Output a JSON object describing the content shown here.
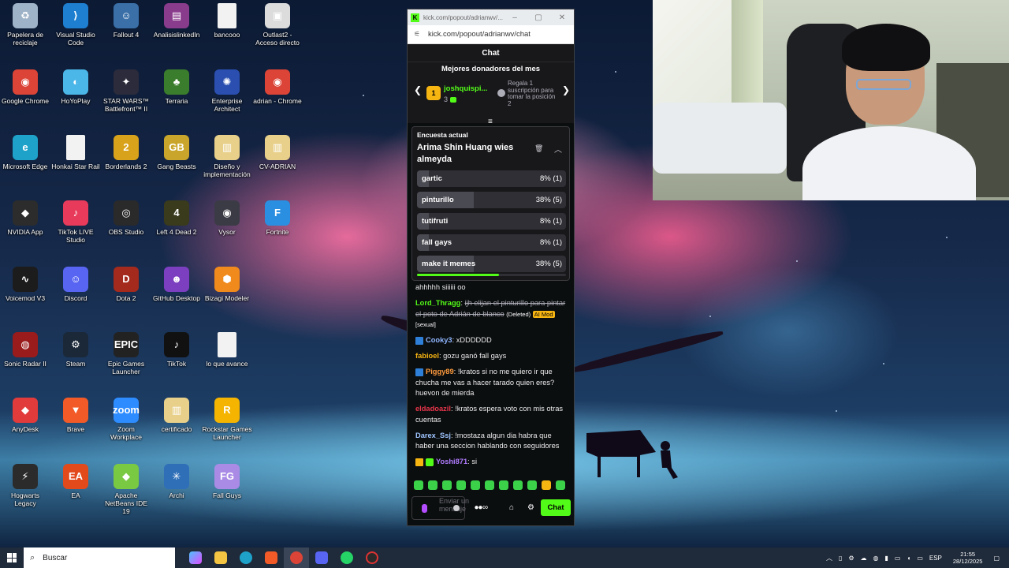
{
  "desktop": {
    "icons": [
      {
        "label": "Papelera de reciclaje",
        "icon": "recycle-bin-icon",
        "color": "#9fb3c8",
        "glyph": "♻"
      },
      {
        "label": "Visual Studio Code",
        "icon": "vscode-icon",
        "color": "#1e7fd0",
        "glyph": "⟩"
      },
      {
        "label": "Fallout 4",
        "icon": "fallout-icon",
        "color": "#3a6fa8",
        "glyph": "☺"
      },
      {
        "label": "AnalisislinkedIn",
        "icon": "winrar-icon",
        "color": "#8a3c8c",
        "glyph": "▤"
      },
      {
        "label": "bancooo",
        "icon": "file-icon",
        "color": "#f2f2f2",
        "glyph": ""
      },
      {
        "label": "Outlast2 - Acceso directo",
        "icon": "shortcut-icon",
        "color": "#dcdcdc",
        "glyph": "▣"
      },
      {
        "label": "Google Chrome",
        "icon": "chrome-icon",
        "color": "#db4437",
        "glyph": "◉"
      },
      {
        "label": "HoYoPlay",
        "icon": "hoyoplay-icon",
        "color": "#4bb6e8",
        "glyph": "◐"
      },
      {
        "label": "STAR WARS™ Battlefront™ II",
        "icon": "starwars-icon",
        "color": "#2b2b3b",
        "glyph": "✦"
      },
      {
        "label": "Terraria",
        "icon": "terraria-icon",
        "color": "#3a7d2c",
        "glyph": "♣"
      },
      {
        "label": "Enterprise Architect",
        "icon": "enterprise-architect-icon",
        "color": "#2a4fb0",
        "glyph": "✺"
      },
      {
        "label": "adrian - Chrome",
        "icon": "chrome-profile-icon",
        "color": "#db4437",
        "glyph": "◉"
      },
      {
        "label": "Microsoft Edge",
        "icon": "edge-icon",
        "color": "#1fa2c9",
        "glyph": "e"
      },
      {
        "label": "Honkai Star Rail",
        "icon": "file-icon",
        "color": "#f2f2f2",
        "glyph": ""
      },
      {
        "label": "Borderlands 2",
        "icon": "borderlands-icon",
        "color": "#d9a21b",
        "glyph": "2"
      },
      {
        "label": "Gang Beasts",
        "icon": "gang-beasts-icon",
        "color": "#c9a62b",
        "glyph": "GB"
      },
      {
        "label": "Diseño y implementación",
        "icon": "folder-doc-icon",
        "color": "#e8d08a",
        "glyph": "▥"
      },
      {
        "label": "CV-ADRIAN",
        "icon": "folder-doc-icon",
        "color": "#e8d08a",
        "glyph": "▥"
      },
      {
        "label": "NVIDIA App",
        "icon": "nvidia-icon",
        "color": "#2c2c2c",
        "glyph": "◆"
      },
      {
        "label": "TikTok LIVE Studio",
        "icon": "tiktok-live-icon",
        "color": "#e83a5b",
        "glyph": "♪"
      },
      {
        "label": "OBS Studio",
        "icon": "obs-icon",
        "color": "#2a2a2a",
        "glyph": "◎"
      },
      {
        "label": "Left 4 Dead 2",
        "icon": "l4d2-icon",
        "color": "#3a3a1c",
        "glyph": "4"
      },
      {
        "label": "Vysor",
        "icon": "vysor-icon",
        "color": "#3b3b45",
        "glyph": "◉"
      },
      {
        "label": "Fortnite",
        "icon": "fortnite-icon",
        "color": "#2a8fe0",
        "glyph": "F"
      },
      {
        "label": "Voicemod V3",
        "icon": "voicemod-icon",
        "color": "#1c1c1c",
        "glyph": "∿"
      },
      {
        "label": "Discord",
        "icon": "discord-icon",
        "color": "#5865f2",
        "glyph": "☺"
      },
      {
        "label": "Dota 2",
        "icon": "dota-icon",
        "color": "#a32a1d",
        "glyph": "D"
      },
      {
        "label": "GitHub Desktop",
        "icon": "github-icon",
        "color": "#7b3fbf",
        "glyph": "☻"
      },
      {
        "label": "Bizagi Modeler",
        "icon": "bizagi-icon",
        "color": "#f08a1c",
        "glyph": "⬢"
      },
      {
        "label": "",
        "icon": "blank-icon",
        "color": "transparent",
        "glyph": ""
      },
      {
        "label": "Sonic Radar II",
        "icon": "sonic-radar-icon",
        "color": "#9a1b1b",
        "glyph": "◍"
      },
      {
        "label": "Steam",
        "icon": "steam-icon",
        "color": "#1b2838",
        "glyph": "⚙"
      },
      {
        "label": "Epic Games Launcher",
        "icon": "epic-games-icon",
        "color": "#222222",
        "glyph": "EPIC"
      },
      {
        "label": "TikTok",
        "icon": "tiktok-icon",
        "color": "#111111",
        "glyph": "♪"
      },
      {
        "label": "lo que avance",
        "icon": "file-icon",
        "color": "#f2f2f2",
        "glyph": ""
      },
      {
        "label": "",
        "icon": "blank-icon",
        "color": "transparent",
        "glyph": ""
      },
      {
        "label": "AnyDesk",
        "icon": "anydesk-icon",
        "color": "#e23b3b",
        "glyph": "◆"
      },
      {
        "label": "Brave",
        "icon": "brave-icon",
        "color": "#f25b28",
        "glyph": "▼"
      },
      {
        "label": "Zoom Workplace",
        "icon": "zoom-icon",
        "color": "#2d8cff",
        "glyph": "zoom"
      },
      {
        "label": "certificado",
        "icon": "folder-doc-icon",
        "color": "#e8d08a",
        "glyph": "▥"
      },
      {
        "label": "Rockstar Games Launcher",
        "icon": "rockstar-icon",
        "color": "#f4b400",
        "glyph": "R"
      },
      {
        "label": "",
        "icon": "blank-icon",
        "color": "transparent",
        "glyph": ""
      },
      {
        "label": "Hogwarts Legacy",
        "icon": "hogwarts-icon",
        "color": "#2b2b2b",
        "glyph": "⚡"
      },
      {
        "label": "EA",
        "icon": "ea-icon",
        "color": "#e24a1c",
        "glyph": "EA"
      },
      {
        "label": "Apache NetBeans IDE 19",
        "icon": "netbeans-icon",
        "color": "#7ac943",
        "glyph": "◆"
      },
      {
        "label": "Archi",
        "icon": "archi-icon",
        "color": "#2f6fb8",
        "glyph": "✳"
      },
      {
        "label": "Fall Guys",
        "icon": "fall-guys-icon",
        "color": "#a98be6",
        "glyph": "FG"
      }
    ]
  },
  "browser": {
    "tab_title": "kick.com/popout/adrianwv/...",
    "url": "kick.com/popout/adrianwv/chat",
    "minimize": "–",
    "maximize": "▢",
    "close": "✕"
  },
  "chat": {
    "header": "Chat",
    "donors": {
      "title": "Mejores donadores del mes",
      "rank": "1",
      "name": "joshquispi...",
      "count": "3",
      "note": "Regala 1 suscripción para tomar la posición 2"
    },
    "poll": {
      "label": "Encuesta actual",
      "question": "Arima Shin Huang wies almeyda",
      "progress": 0.55,
      "options": [
        {
          "label": "gartic",
          "result": "8% (1)",
          "percent": 8
        },
        {
          "label": "pinturillo",
          "result": "38% (5)",
          "percent": 38
        },
        {
          "label": "tutifruti",
          "result": "8% (1)",
          "percent": 8
        },
        {
          "label": "fall gays",
          "result": "8% (1)",
          "percent": 8
        },
        {
          "label": "make it memes",
          "result": "38% (5)",
          "percent": 38
        }
      ]
    },
    "messages": [
      {
        "user": "",
        "color": "#ffffff",
        "text": "ahhhhh siiiiii oo",
        "badge": ""
      },
      {
        "user": "Lord_Thragg",
        "color": "#53fc18",
        "text": "ijh elijan el pinturillo para pintar el poto de Adrián de blanco",
        "badge": "",
        "deleted": "(Deleted)",
        "mod": "AI Mod",
        "reason": "[sexual]"
      },
      {
        "user": "Cooky3",
        "color": "#8fb6ff",
        "text": "xDDDDDD",
        "badge": "blue"
      },
      {
        "user": "fabioel",
        "color": "#f7b512",
        "text": "gozu ganó fall gays",
        "badge": ""
      },
      {
        "user": "Piggy89",
        "color": "#ff9b3d",
        "text": "!kratos si no me quiero ir que chucha me vas a hacer tarado quien eres? huevon de mierda",
        "badge": "blue"
      },
      {
        "user": "eldadoazil",
        "color": "#e8354b",
        "text": "!kratos espera voto con mis otras cuentas",
        "badge": ""
      },
      {
        "user": "Darex_Ssj",
        "color": "#9ec5ff",
        "text": "!mostaza algun dia habra que haber una seccion hablando con seguidores",
        "badge": ""
      },
      {
        "user": "Yoshi871",
        "color": "#b07cff",
        "text": "si",
        "badge": "crown"
      }
    ],
    "input_placeholder": "Enviar un mensaje",
    "send_label": "Chat"
  },
  "taskbar": {
    "search_placeholder": "Buscar",
    "language": "ESP",
    "time": "21:55",
    "date": "28/12/2025"
  }
}
